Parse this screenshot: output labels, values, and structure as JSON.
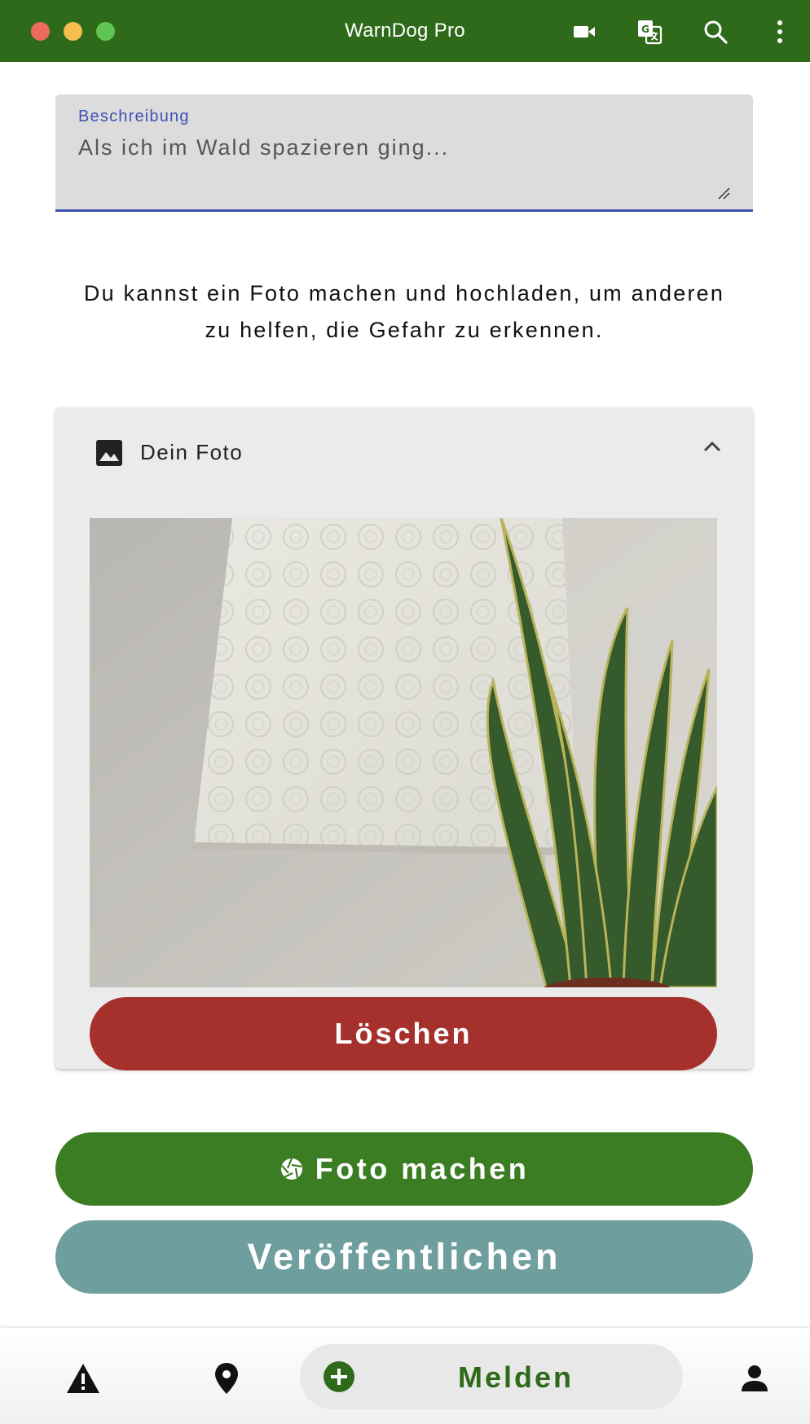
{
  "window": {
    "title": "WarnDog Pro",
    "toolbar_icons": [
      "video-camera-icon",
      "translate-icon",
      "search-icon",
      "more-vertical-icon"
    ]
  },
  "description_field": {
    "label": "Beschreibung",
    "value": "Als ich im Wald spazieren ging..."
  },
  "hint": {
    "text": "Du kannst ein Foto machen und hochladen, um anderen zu helfen, die Gefahr zu erkennen."
  },
  "photo_card": {
    "title": "Dein Foto",
    "icon": "image-icon",
    "expanded": true,
    "delete_label": "Löschen"
  },
  "actions": {
    "take_photo_label": "Foto machen",
    "publish_label": "Veröffentlichen"
  },
  "bottom_nav": {
    "items": [
      {
        "icon": "warning-icon"
      },
      {
        "icon": "location-pin-icon"
      },
      {
        "icon": "add-circle-icon",
        "label": "Melden"
      },
      {
        "icon": "person-icon"
      }
    ]
  },
  "colors": {
    "titlebar": "#2e6a1a",
    "field_accent": "#3f51b5",
    "delete": "#a5302c",
    "take_photo": "#3b7d22",
    "publish": "#6f9e9f",
    "report_text": "#2e6a1a"
  }
}
